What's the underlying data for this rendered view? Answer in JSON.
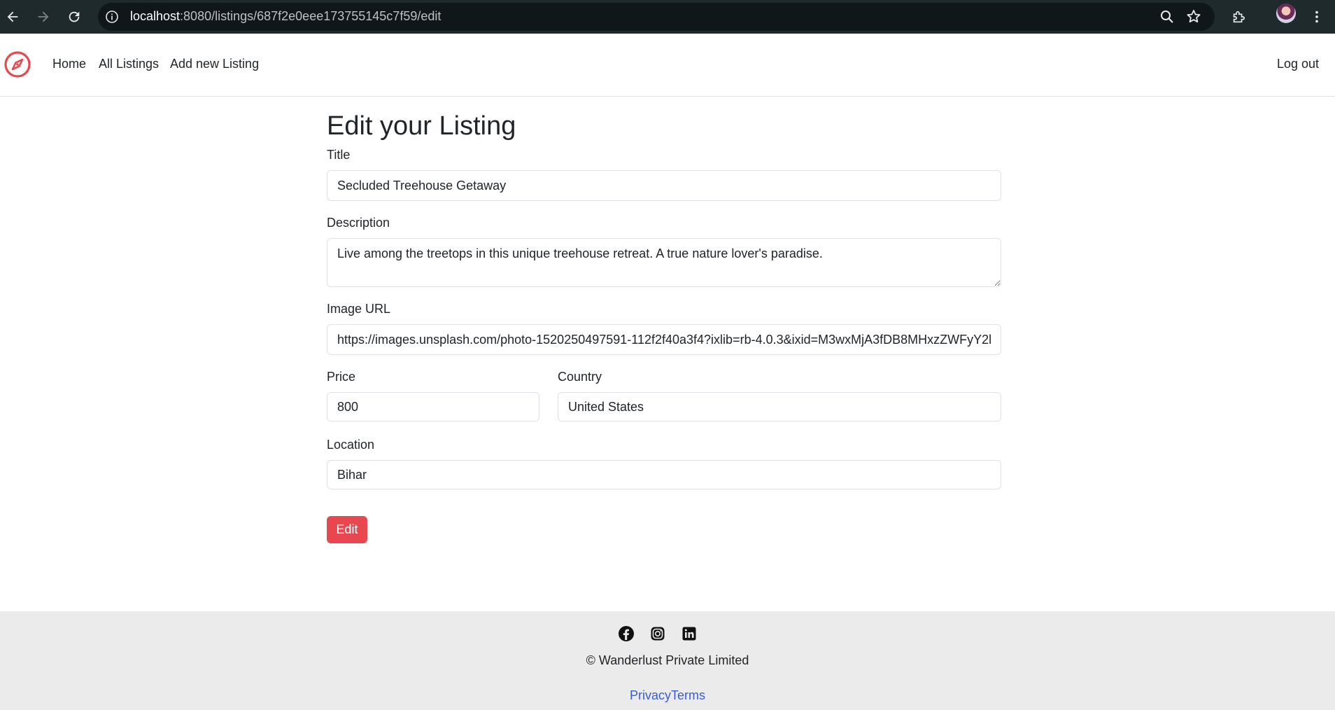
{
  "browser": {
    "url_host": "localhost",
    "url_path": ":8080/listings/687f2e0eee173755145c7f59/edit"
  },
  "navbar": {
    "brand_icon": "compass-icon",
    "links": [
      "Home",
      "All Listings",
      "Add new Listing"
    ],
    "logout_label": "Log out"
  },
  "form": {
    "heading": "Edit your Listing",
    "title_label": "Title",
    "title_value": "Secluded Treehouse Getaway",
    "description_label": "Description",
    "description_value": "Live among the treetops in this unique treehouse retreat. A true nature lover's paradise.",
    "image_label": "Image URL",
    "image_value": "https://images.unsplash.com/photo-1520250497591-112f2f40a3f4?ixlib=rb-4.0.3&ixid=M3wxMjA3fDB8MHxzZWFyY2l",
    "price_label": "Price",
    "price_value": "800",
    "country_label": "Country",
    "country_value": "United States",
    "location_label": "Location",
    "location_value": "Bihar",
    "submit_label": "Edit"
  },
  "footer": {
    "social_icons": [
      "facebook-icon",
      "instagram-icon",
      "linkedin-icon"
    ],
    "copyright": "© Wanderlust Private Limited",
    "privacy_label": "Privacy",
    "terms_label": "Terms"
  },
  "colors": {
    "accent": "#e8474f",
    "link": "#3b5bdb",
    "footer_bg": "#ebebeb"
  }
}
